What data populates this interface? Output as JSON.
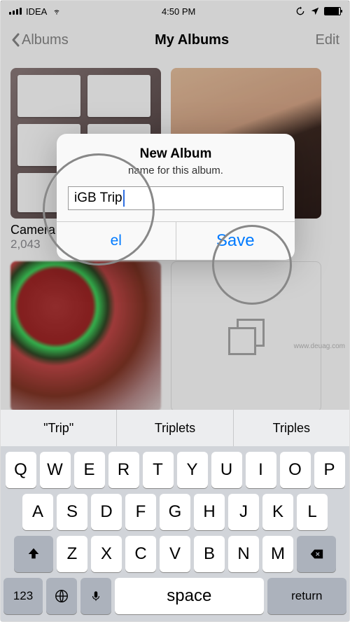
{
  "status": {
    "carrier": "IDEA",
    "time": "4:50 PM"
  },
  "nav": {
    "back": "Albums",
    "title": "My Albums",
    "edit": "Edit"
  },
  "grid": {
    "albums": [
      {
        "name": "Camera Roll",
        "count": "2,043"
      }
    ]
  },
  "alert": {
    "title": "New Album",
    "message": "name for this album.",
    "input_value": "iGB Trip",
    "cancel_fragment": "el",
    "save": "Save"
  },
  "suggestions": {
    "a": "\"Trip\"",
    "b": "Triplets",
    "c": "Triples"
  },
  "keys": {
    "r1": [
      "Q",
      "W",
      "E",
      "R",
      "T",
      "Y",
      "U",
      "I",
      "O",
      "P"
    ],
    "r2": [
      "A",
      "S",
      "D",
      "F",
      "G",
      "H",
      "J",
      "K",
      "L"
    ],
    "r3": [
      "Z",
      "X",
      "C",
      "V",
      "B",
      "N",
      "M"
    ],
    "num": "123",
    "space": "space",
    "return": "return"
  },
  "watermark": "www.deuag.com"
}
